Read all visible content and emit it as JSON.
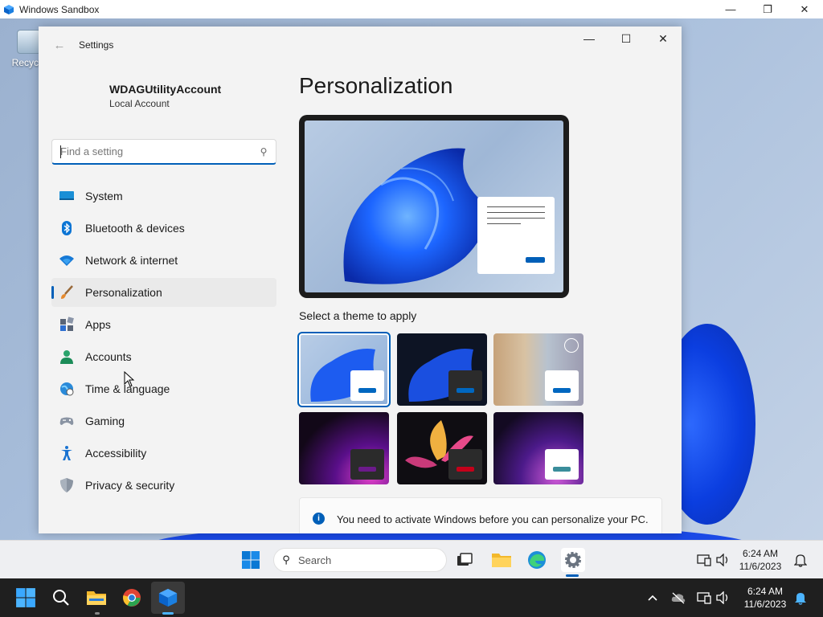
{
  "host_window": {
    "title": "Windows Sandbox",
    "controls": {
      "minimize": "—",
      "maximize": "❐",
      "close": "✕"
    }
  },
  "desktop": {
    "recycle_bin_label": "Recycle"
  },
  "settings": {
    "window_title": "Settings",
    "controls": {
      "minimize": "—",
      "maximize": "☐",
      "close": "✕"
    },
    "profile": {
      "name": "WDAGUtilityAccount",
      "type": "Local Account"
    },
    "search": {
      "placeholder": "Find a setting"
    },
    "nav": [
      {
        "label": "System",
        "icon": "monitor-icon"
      },
      {
        "label": "Bluetooth & devices",
        "icon": "bluetooth-icon"
      },
      {
        "label": "Network & internet",
        "icon": "wifi-icon"
      },
      {
        "label": "Personalization",
        "icon": "brush-icon",
        "active": true
      },
      {
        "label": "Apps",
        "icon": "apps-icon"
      },
      {
        "label": "Accounts",
        "icon": "person-icon"
      },
      {
        "label": "Time & language",
        "icon": "globe-clock-icon"
      },
      {
        "label": "Gaming",
        "icon": "gamepad-icon"
      },
      {
        "label": "Accessibility",
        "icon": "accessibility-icon"
      },
      {
        "label": "Privacy & security",
        "icon": "shield-icon"
      }
    ],
    "page_title": "Personalization",
    "theme_label": "Select a theme to apply",
    "notice": "You need to activate Windows before you can personalize your PC."
  },
  "guest_taskbar": {
    "search_label": "Search",
    "time": "6:24 AM",
    "date": "11/6/2023"
  },
  "host_taskbar": {
    "time": "6:24 AM",
    "date": "11/6/2023"
  },
  "colors": {
    "accent": "#005fb8",
    "theme_bars": [
      "#0067c0",
      "#0067c0",
      "#0067c0",
      "#6b1a8a",
      "#c4001a",
      "#3a8d9b"
    ]
  }
}
